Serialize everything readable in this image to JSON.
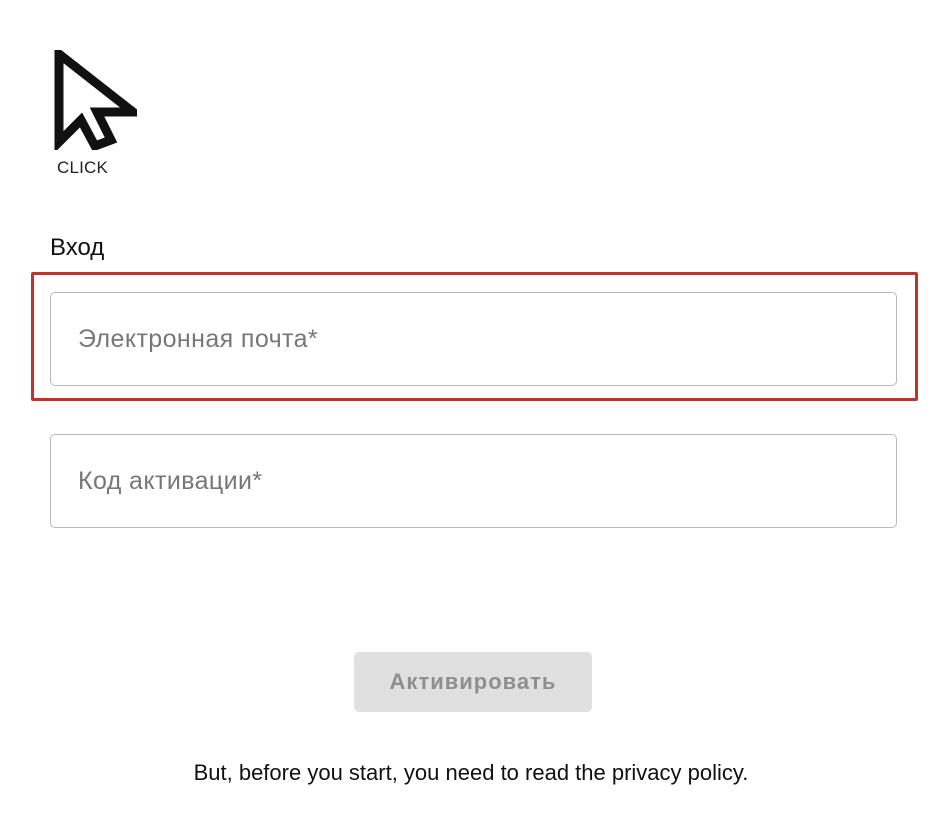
{
  "logo": {
    "text": "CLICK",
    "icon": "cursor-arrow-icon"
  },
  "form": {
    "title": "Вход",
    "email": {
      "placeholder": "Электронная почта*",
      "value": ""
    },
    "activation_code": {
      "placeholder": "Код активации*",
      "value": ""
    },
    "submit_label": "Активировать",
    "submit_enabled": false
  },
  "notice": {
    "text": "But, before you start, you need to read the privacy policy."
  },
  "colors": {
    "highlight": "#c4302b",
    "button_bg": "#e0e0e0",
    "button_text": "#8f8f8f",
    "field_border": "#b9b9b9"
  }
}
